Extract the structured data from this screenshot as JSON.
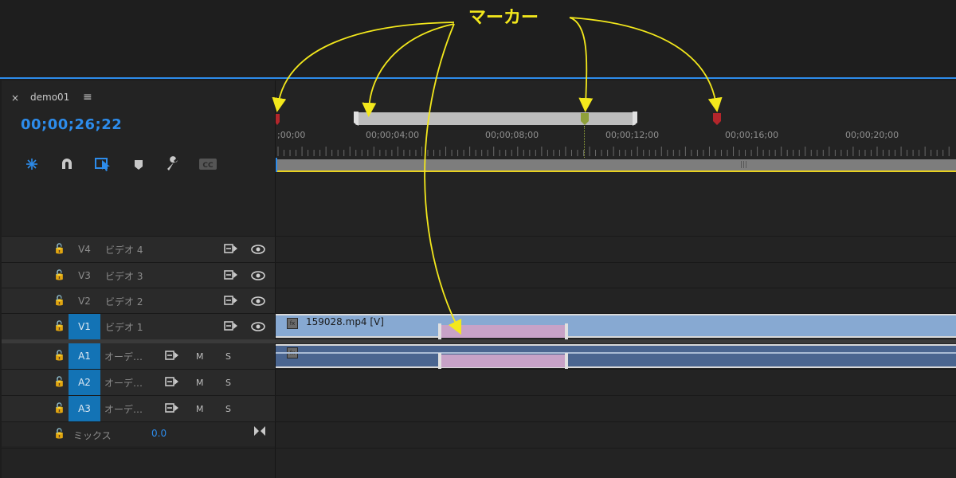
{
  "annotation": {
    "label": "マーカー"
  },
  "sequence": {
    "tab_close": "×",
    "tab_name": "demo01",
    "tab_menu": "≡",
    "timecode": "00;00;26;22"
  },
  "toolbar": {
    "icons": [
      "snap-icon",
      "magnet-icon",
      "linked-selection-icon",
      "add-marker-icon",
      "wrench-icon",
      "captions-icon"
    ],
    "captions_label": "CC"
  },
  "ruler": {
    "ticks": [
      ";00;00",
      "00;00;04;00",
      "00;00;08;00",
      "00;00;12;00",
      "00;00;16;00",
      "00;00;20;00"
    ]
  },
  "tracks": {
    "video": [
      {
        "id": "V4",
        "name": "ビデオ 4"
      },
      {
        "id": "V3",
        "name": "ビデオ 3"
      },
      {
        "id": "V2",
        "name": "ビデオ 2"
      },
      {
        "id": "V1",
        "name": "ビデオ 1"
      }
    ],
    "audio": [
      {
        "id": "A1",
        "name": "オーデ…",
        "m": "M",
        "s": "S"
      },
      {
        "id": "A2",
        "name": "オーデ…",
        "m": "M",
        "s": "S"
      },
      {
        "id": "A3",
        "name": "オーデ…",
        "m": "M",
        "s": "S"
      }
    ],
    "mix": {
      "name": "ミックス",
      "value": "0.0"
    }
  },
  "clips": {
    "video_clip_name": "159028.mp4 [V]",
    "fx_badge": "fx"
  },
  "colors": {
    "accent": "#2d8ceb",
    "annotation": "#f3e81c",
    "marker_red": "#b3262b",
    "marker_green": "#8fa03a"
  }
}
